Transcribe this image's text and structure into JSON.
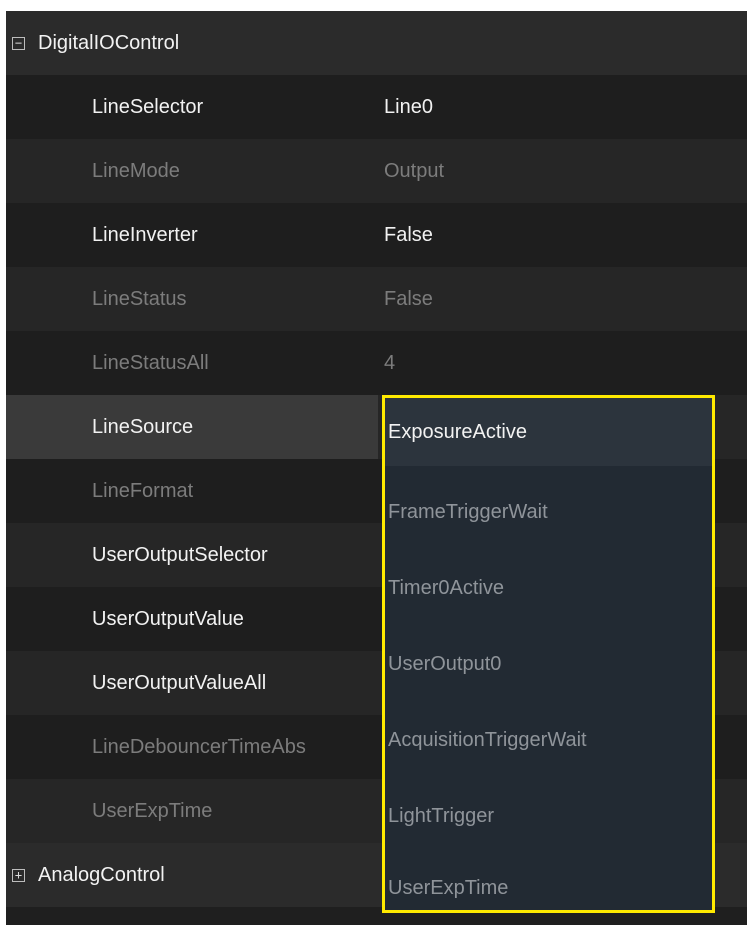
{
  "groups": [
    {
      "label": "DigitalIOControl",
      "toggle": "−"
    },
    {
      "label": "AnalogControl",
      "toggle": "+"
    }
  ],
  "properties": [
    {
      "name": "LineSelector",
      "value": "Line0"
    },
    {
      "name": "LineMode",
      "value": "Output"
    },
    {
      "name": "LineInverter",
      "value": "False"
    },
    {
      "name": "LineStatus",
      "value": "False"
    },
    {
      "name": "LineStatusAll",
      "value": "4"
    },
    {
      "name": "LineSource",
      "value": ""
    },
    {
      "name": "LineFormat",
      "value": ""
    },
    {
      "name": "UserOutputSelector",
      "value": ""
    },
    {
      "name": "UserOutputValue",
      "value": ""
    },
    {
      "name": "UserOutputValueAll",
      "value": ""
    },
    {
      "name": "LineDebouncerTimeAbs",
      "value": ""
    },
    {
      "name": "UserExpTime",
      "value": ""
    }
  ],
  "dropdown": {
    "options": [
      "ExposureActive",
      "FrameTriggerWait",
      "Timer0Active",
      "UserOutput0",
      "AcquisitionTriggerWait",
      "LightTrigger",
      "UserExpTime"
    ],
    "selected": "ExposureActive"
  },
  "colors": {
    "background": "#1f1f1f",
    "row_alt": "#262626",
    "group_row": "#2b2b2b",
    "selected_row": "#3a3a3a",
    "text_enabled": "#f2f2f2",
    "text_disabled": "#7c7c7c",
    "dropdown_bg": "#222a33",
    "dropdown_highlight": "#2c343d",
    "dropdown_border": "#ffea00"
  }
}
